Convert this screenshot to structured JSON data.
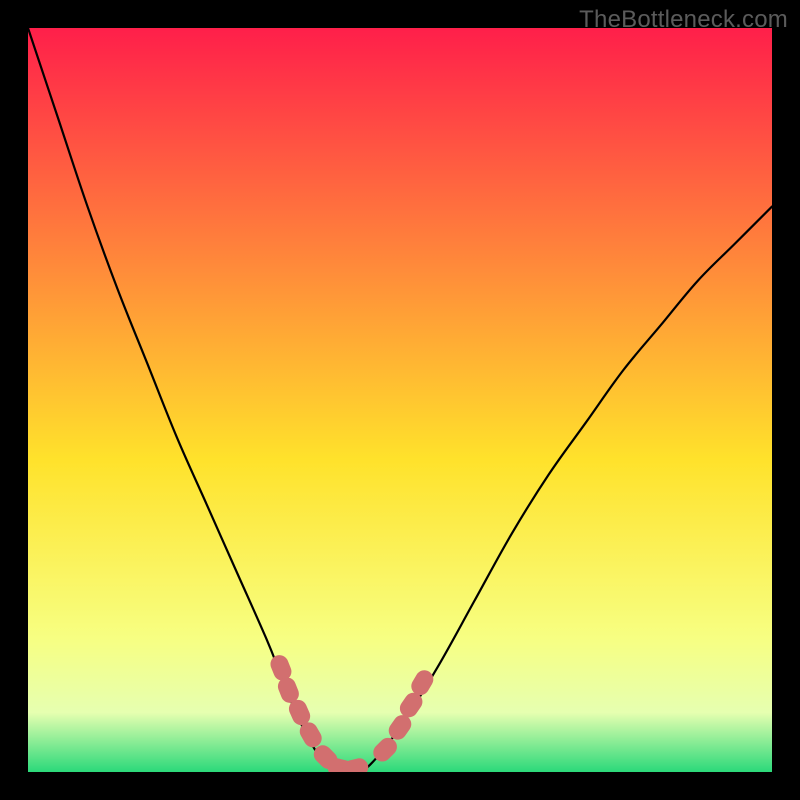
{
  "watermark": "TheBottleneck.com",
  "colors": {
    "frame": "#000000",
    "gradient_top": "#ff1f4a",
    "gradient_mid_upper": "#ff8a3a",
    "gradient_mid": "#ffe22b",
    "gradient_lower": "#f7ff82",
    "gradient_band": "#e6ffb0",
    "gradient_bottom": "#2bd97a",
    "curve": "#000000",
    "marker": "#d26f6f"
  },
  "chart_data": {
    "type": "line",
    "title": "",
    "xlabel": "",
    "ylabel": "",
    "xlim": [
      0,
      100
    ],
    "ylim": [
      0,
      100
    ],
    "grid": false,
    "series": [
      {
        "name": "bottleneck-curve",
        "x": [
          0,
          4,
          8,
          12,
          16,
          20,
          24,
          28,
          32,
          34,
          36,
          38,
          40,
          42,
          44,
          46,
          50,
          55,
          60,
          65,
          70,
          75,
          80,
          85,
          90,
          95,
          100
        ],
        "y": [
          100,
          88,
          76,
          65,
          55,
          45,
          36,
          27,
          18,
          13,
          8,
          4,
          1,
          0,
          0,
          1,
          6,
          14,
          23,
          32,
          40,
          47,
          54,
          60,
          66,
          71,
          76
        ]
      }
    ],
    "markers": [
      {
        "name": "left-cluster",
        "points": [
          {
            "x": 34,
            "y": 14
          },
          {
            "x": 35,
            "y": 11
          },
          {
            "x": 36.5,
            "y": 8
          },
          {
            "x": 38,
            "y": 5
          },
          {
            "x": 40,
            "y": 2
          },
          {
            "x": 42,
            "y": 0.5
          },
          {
            "x": 44,
            "y": 0.5
          }
        ]
      },
      {
        "name": "right-cluster",
        "points": [
          {
            "x": 48,
            "y": 3
          },
          {
            "x": 50,
            "y": 6
          },
          {
            "x": 51.5,
            "y": 9
          },
          {
            "x": 53,
            "y": 12
          }
        ]
      }
    ],
    "annotations": []
  }
}
